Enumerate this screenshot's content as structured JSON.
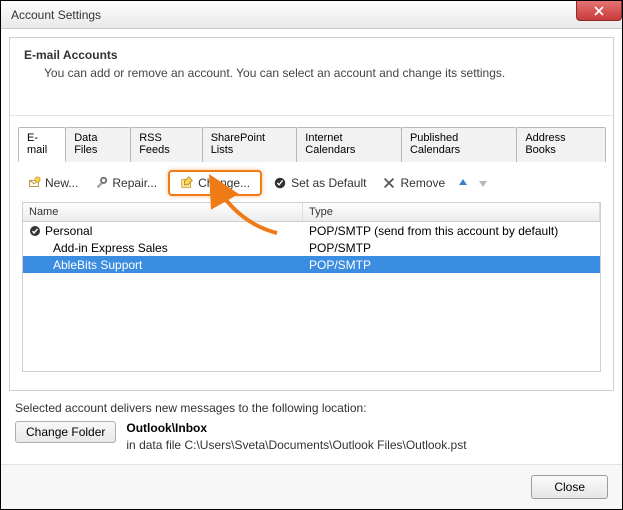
{
  "window": {
    "title": "Account Settings"
  },
  "header": {
    "title": "E-mail Accounts",
    "subtitle": "You can add or remove an account. You can select an account and change its settings."
  },
  "tabs": [
    {
      "label": "E-mail",
      "active": true
    },
    {
      "label": "Data Files"
    },
    {
      "label": "RSS Feeds"
    },
    {
      "label": "SharePoint Lists"
    },
    {
      "label": "Internet Calendars"
    },
    {
      "label": "Published Calendars"
    },
    {
      "label": "Address Books"
    }
  ],
  "toolbar": {
    "new_label": "New...",
    "repair_label": "Repair...",
    "change_label": "Change...",
    "setdefault_label": "Set as Default",
    "remove_label": "Remove"
  },
  "table": {
    "columns": {
      "name": "Name",
      "type": "Type"
    },
    "rows": [
      {
        "name": "Personal",
        "type": "POP/SMTP (send from this account by default)",
        "default": true,
        "selected": false
      },
      {
        "name": "Add-in Express Sales",
        "type": "POP/SMTP",
        "default": false,
        "selected": false
      },
      {
        "name": "AbleBits Support",
        "type": "POP/SMTP",
        "default": false,
        "selected": true
      }
    ]
  },
  "location": {
    "intro": "Selected account delivers new messages to the following location:",
    "change_folder_label": "Change Folder",
    "folder": "Outlook\\Inbox",
    "datafile_prefix": "in data file ",
    "datafile": "C:\\Users\\Sveta\\Documents\\Outlook Files\\Outlook.pst"
  },
  "footer": {
    "close_label": "Close"
  }
}
